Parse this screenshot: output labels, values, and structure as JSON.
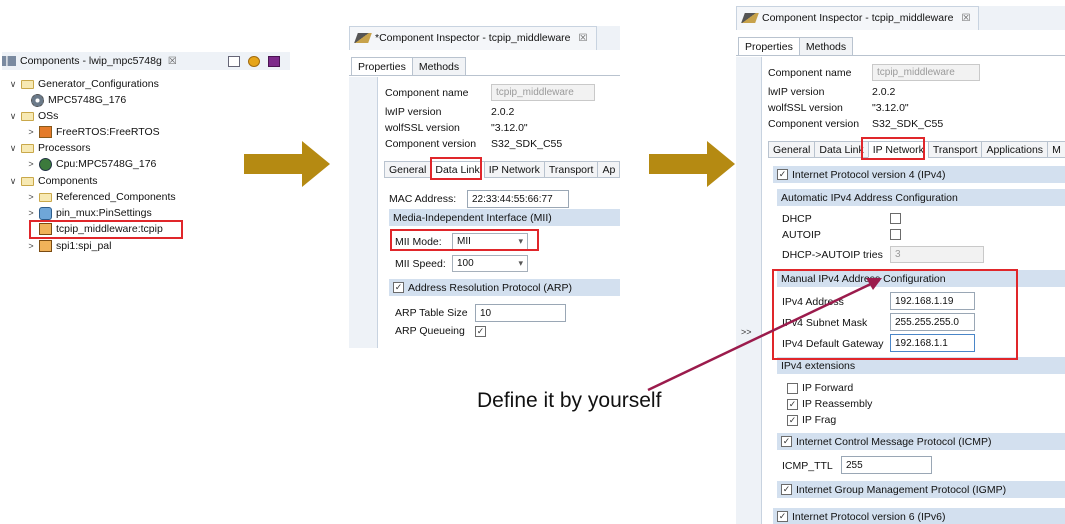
{
  "tree": {
    "title": "Components - lwip_mpc5748g",
    "close": "☒",
    "items": [
      {
        "chev": "∨",
        "label": "Generator_Configurations"
      },
      {
        "chev": "",
        "label": "MPC5748G_176"
      },
      {
        "chev": "∨",
        "label": "OSs"
      },
      {
        "chev": ">",
        "label": "FreeRTOS:FreeRTOS"
      },
      {
        "chev": "∨",
        "label": "Processors"
      },
      {
        "chev": ">",
        "label": "Cpu:MPC5748G_176"
      },
      {
        "chev": "∨",
        "label": "Components"
      },
      {
        "chev": ">",
        "label": "Referenced_Components"
      },
      {
        "chev": ">",
        "label": "pin_mux:PinSettings"
      },
      {
        "chev": "",
        "label": "tcpip_middleware:tcpip"
      },
      {
        "chev": ">",
        "label": "spi1:spi_pal"
      }
    ]
  },
  "inspector1": {
    "tab_title": "*Component Inspector - tcpip_middleware",
    "close": "☒",
    "prop_tabs": [
      "Properties",
      "Methods"
    ],
    "fields": [
      {
        "label": "Component name",
        "value": "tcpip_middleware"
      },
      {
        "label": "lwIP version",
        "value": "2.0.2"
      },
      {
        "label": "wolfSSL version",
        "value": "\"3.12.0\""
      },
      {
        "label": "Component version",
        "value": "S32_SDK_C55"
      }
    ],
    "subtabs": [
      "General",
      "Data Link",
      "IP Network",
      "Transport",
      "Ap"
    ],
    "mac_label": "MAC Address:",
    "mac_value": "22:33:44:55:66:77",
    "mii_section": "Media-Independent Interface (MII)",
    "mii_mode_label": "MII Mode:",
    "mii_mode_value": "MII",
    "mii_speed_label": "MII Speed:",
    "mii_speed_value": "100",
    "arp_section": "Address Resolution Protocol (ARP)",
    "arp_table_label": "ARP Table Size",
    "arp_table_value": "10",
    "arp_queue_label": "ARP Queueing",
    "check": "✓"
  },
  "inspector2": {
    "tab_title": "Component Inspector - tcpip_middleware",
    "close": "☒",
    "prop_tabs": [
      "Properties",
      "Methods"
    ],
    "gutter_btn": ">>",
    "fields": [
      {
        "label": "Component name",
        "value": "tcpip_middleware"
      },
      {
        "label": "lwIP version",
        "value": "2.0.2"
      },
      {
        "label": "wolfSSL version",
        "value": "\"3.12.0\""
      },
      {
        "label": "Component version",
        "value": "S32_SDK_C55"
      }
    ],
    "subtabs": [
      "General",
      "Data Link",
      "IP Network",
      "Transport",
      "Applications",
      "M"
    ],
    "ipv4_section": "Internet Protocol version 4 (IPv4)",
    "auto_section": "Automatic IPv4 Address Configuration",
    "dhcp_label": "DHCP",
    "autoip_label": "AUTOIP",
    "tries_label": "DHCP->AUTOIP tries",
    "tries_value": "3",
    "manual_section": "Manual IPv4 Address Configuration",
    "ip_label": "IPv4 Address",
    "ip_value": "192.168.1.19",
    "mask_label": "IPv4 Subnet Mask",
    "mask_value": "255.255.255.0",
    "gw_label": "IPv4 Default Gateway",
    "gw_value": "192.168.1.1",
    "ext_section": "IPv4 extensions",
    "ext_items": [
      {
        "label": "IP Forward",
        "checked": false
      },
      {
        "label": "IP Reassembly",
        "checked": true
      },
      {
        "label": "IP Frag",
        "checked": true
      }
    ],
    "icmp_section": "Internet Control Message Protocol (ICMP)",
    "icmp_ttl_label": "ICMP_TTL",
    "icmp_ttl_value": "255",
    "igmp_section": "Internet Group Management Protocol (IGMP)",
    "ipv6_section": "Internet Protocol version 6 (IPv6)",
    "check": "✓"
  },
  "annotation": "Define it by yourself",
  "colors": {
    "highlight": "#e0262a",
    "arrow": "#b58a12",
    "pointer": "#9b1b4c"
  }
}
